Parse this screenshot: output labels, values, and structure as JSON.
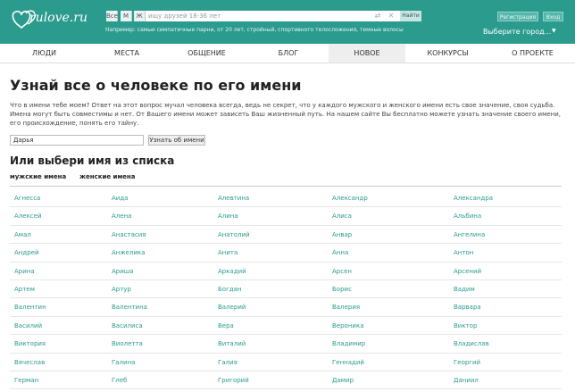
{
  "header": {
    "logo_text": "rulove.ru",
    "gender_options": [
      "Все",
      "М",
      "Ж"
    ],
    "search_placeholder": "ищу друзей 18-36 лет",
    "find_label": "Найти",
    "example_text": "Например: самые симпатичные парни, от 20 лет, стройный, спортивного телосложения, темные волосы",
    "register_label": "Регистрация",
    "login_label": "Вход",
    "city_label": "Выберите город..."
  },
  "nav": {
    "items": [
      "ЛЮДИ",
      "МЕСТА",
      "ОБЩЕНИЕ",
      "БЛОГ",
      "НОВОЕ",
      "КОНКУРСЫ",
      "О ПРОЕКТЕ"
    ],
    "active": "НОВОЕ"
  },
  "main": {
    "title": "Узнай все о человеке по его имени",
    "intro": "Что в имени тебе моем? Ответ на этот вопрос мучал человека всегда, ведь не секрет, что у каждого мужского и женского имени есть свое значение, своя судьба. Имена могут быть совместимы и нет. От Вашего имени может зависеть Ваш жизненный путь. На нашем сайте Вы бесплатно можете узнать значение своего имени, его происхождение, понять его тайну.",
    "name_value": "Дарья",
    "name_button": "Узнать об имени",
    "list_title": "Или выбери имя из списка",
    "tab_male": "мужские имена",
    "tab_female": "женские имена"
  },
  "names": [
    [
      "Агнесса",
      "Аида",
      "Алевтина",
      "Александр",
      "Александра"
    ],
    [
      "Алексей",
      "Алена",
      "Алина",
      "Алиса",
      "Альбина"
    ],
    [
      "Амал",
      "Анастасия",
      "Анатолий",
      "Анвар",
      "Ангелина"
    ],
    [
      "Андрей",
      "Анжелика",
      "Анита",
      "Анна",
      "Антон"
    ],
    [
      "Арина",
      "Ариша",
      "Аркадий",
      "Арсен",
      "Арсений"
    ],
    [
      "Артем",
      "Артур",
      "Богдан",
      "Борис",
      "Вадим"
    ],
    [
      "Валентин",
      "Валентина",
      "Валерий",
      "Валерия",
      "Варвара"
    ],
    [
      "Василий",
      "Василиса",
      "Вера",
      "Вероника",
      "Виктор"
    ],
    [
      "Виктория",
      "Виолетта",
      "Виталий",
      "Владимир",
      "Владислав"
    ],
    [
      "Вячеслав",
      "Галина",
      "Галия",
      "Геннадий",
      "Георгий"
    ],
    [
      "Герман",
      "Глеб",
      "Григорий",
      "Дамир",
      "Даниил"
    ]
  ],
  "colors": {
    "brand": "#2b9b8e",
    "link": "#2b9b8e",
    "active_tab_bg": "#eeeeee"
  },
  "icons": [
    "heart-logo-icon",
    "swap-icon",
    "clear-icon",
    "chevron-down-icon"
  ]
}
